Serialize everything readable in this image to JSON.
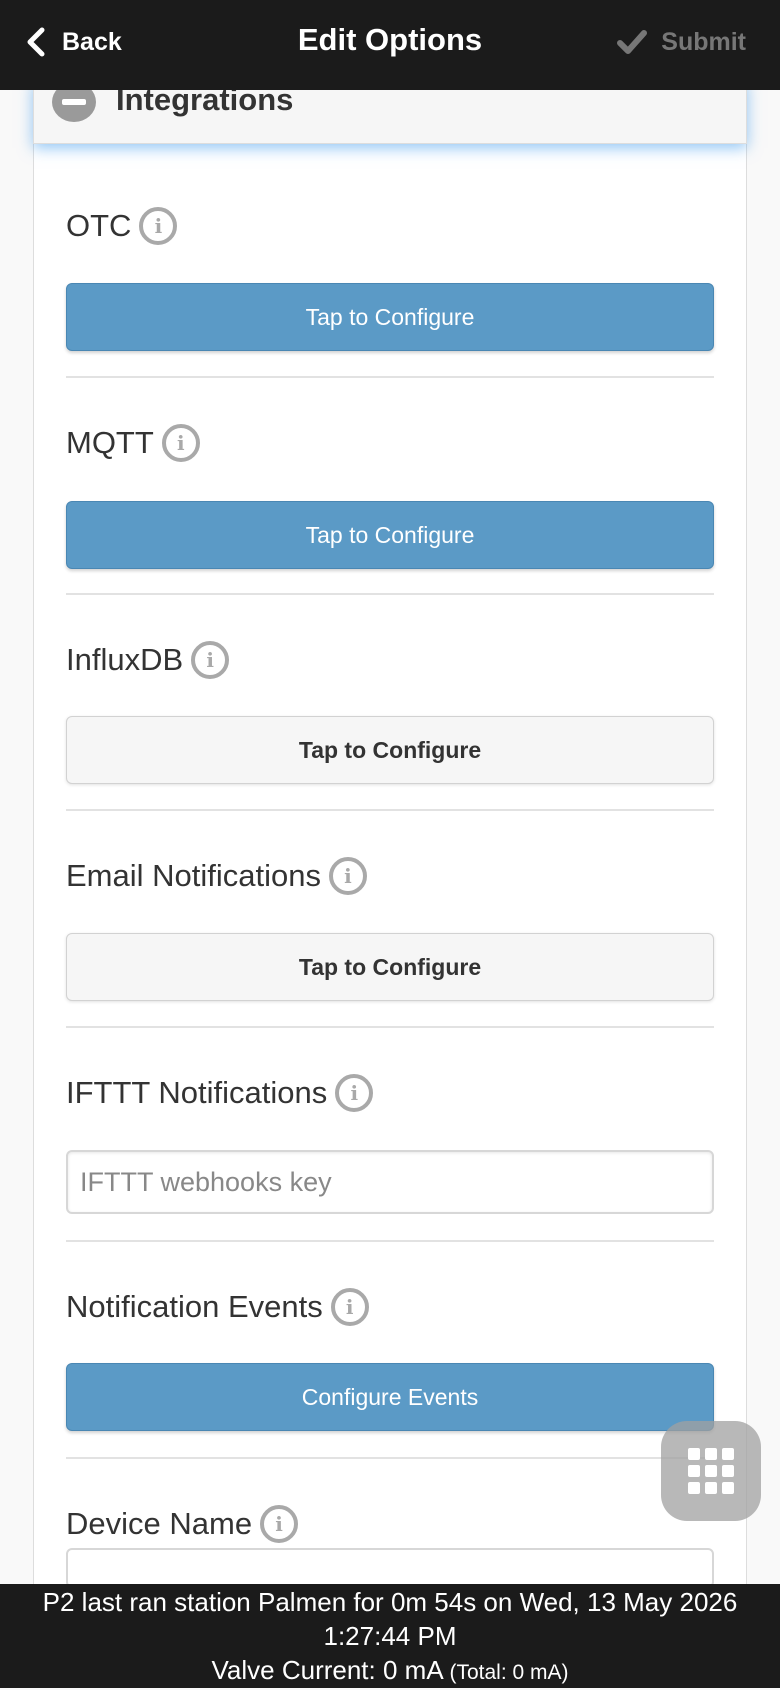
{
  "header": {
    "back_label": "Back",
    "title": "Edit Options",
    "submit_label": "Submit"
  },
  "section": {
    "title": "Integrations"
  },
  "fields": [
    {
      "label": "OTC",
      "control": "button",
      "style": "blue",
      "button_label": "Tap to Configure"
    },
    {
      "label": "MQTT",
      "control": "button",
      "style": "blue",
      "button_label": "Tap to Configure"
    },
    {
      "label": "InfluxDB",
      "control": "button",
      "style": "gray",
      "button_label": "Tap to Configure"
    },
    {
      "label": "Email Notifications",
      "control": "button",
      "style": "gray",
      "button_label": "Tap to Configure"
    },
    {
      "label": "IFTTT Notifications",
      "control": "input",
      "placeholder": "IFTTT webhooks key",
      "value": ""
    },
    {
      "label": "Notification Events",
      "control": "button",
      "style": "blue",
      "button_label": "Configure Events"
    },
    {
      "label": "Device Name",
      "control": "input",
      "placeholder": "",
      "value": ""
    }
  ],
  "footer": {
    "status_line": "P2 last ran station Palmen for 0m 54s on Wed, 13 May 2026 1:27:44 PM",
    "valve_current": "Valve Current: 0 mA",
    "total": "(Total: 0 mA)"
  },
  "icons": {
    "back": "chevron-left-icon",
    "submit": "checkmark-icon",
    "section": "minus-circle-icon",
    "info": "info-icon",
    "fab": "grid-menu-icon"
  },
  "colors": {
    "header_bg": "#1b1b1b",
    "accent_blue": "#5b9ac6",
    "submit_disabled": "#777777"
  }
}
